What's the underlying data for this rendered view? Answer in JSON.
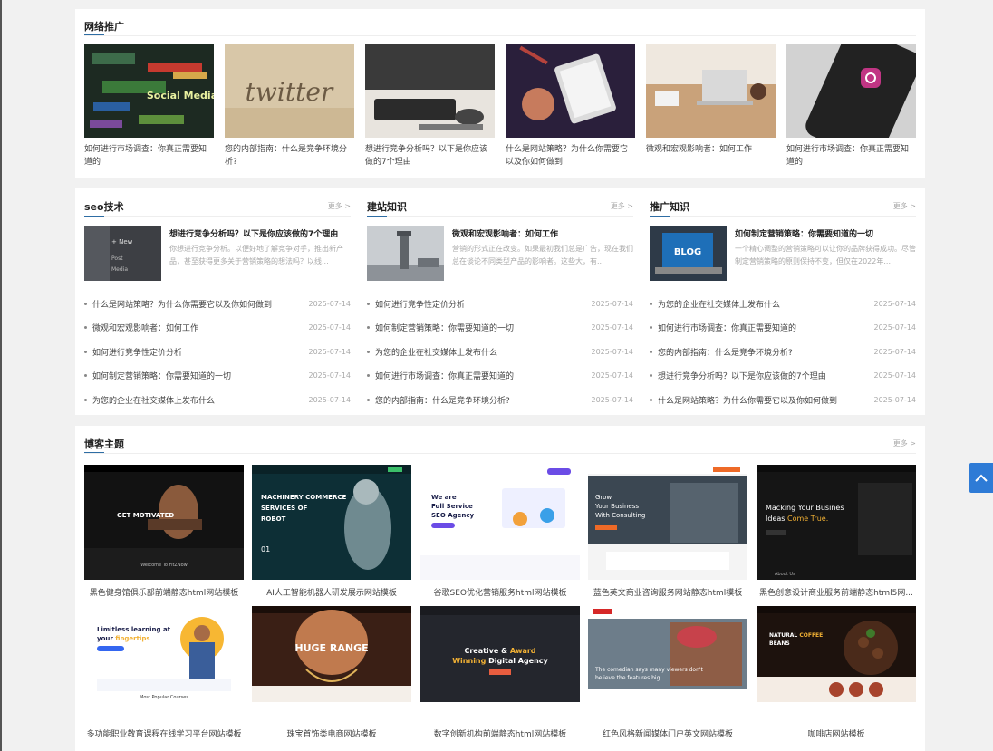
{
  "promo": {
    "title": "网络推广",
    "items": [
      {
        "caption": "如何进行市场调查：你真正需要知道的"
      },
      {
        "caption": "您的内部指南：什么是竞争环境分析?"
      },
      {
        "caption": "想进行竞争分析吗？以下是你应该做的7个理由"
      },
      {
        "caption": "什么是网站策略？为什么你需要它以及你如何做到"
      },
      {
        "caption": "微观和宏观影响者：如何工作"
      },
      {
        "caption": "如何进行市场调查：你真正需要知道的"
      }
    ]
  },
  "columns": [
    {
      "title": "seo技术",
      "more": "更多 >",
      "featured": {
        "title": "想进行竞争分析吗？以下是你应该做的7个理由",
        "desc": "你想进行竞争分析。以便好地了解竞争对手，推出新产品，甚至获得更多关于营销策略的想法吗？以线..."
      },
      "items": [
        {
          "text": "什么是网站策略？为什么你需要它以及你如何做到",
          "date": "2025-07-14"
        },
        {
          "text": "微观和宏观影响者：如何工作",
          "date": "2025-07-14"
        },
        {
          "text": "如何进行竞争性定价分析",
          "date": "2025-07-14"
        },
        {
          "text": "如何制定营销策略：你需要知道的一切",
          "date": "2025-07-14"
        },
        {
          "text": "为您的企业在社交媒体上发布什么",
          "date": "2025-07-14"
        }
      ]
    },
    {
      "title": "建站知识",
      "more": "更多 >",
      "featured": {
        "title": "微观和宏观影响者：如何工作",
        "desc": "营销的形式正在改变。如果最初我们总是广告，现在我们总在谈论不同类型产品的影响者。这些大，有..."
      },
      "items": [
        {
          "text": "如何进行竞争性定价分析",
          "date": "2025-07-14"
        },
        {
          "text": "如何制定营销策略：你需要知道的一切",
          "date": "2025-07-14"
        },
        {
          "text": "为您的企业在社交媒体上发布什么",
          "date": "2025-07-14"
        },
        {
          "text": "如何进行市场调查：你真正需要知道的",
          "date": "2025-07-14"
        },
        {
          "text": "您的内部指南：什么是竞争环境分析?",
          "date": "2025-07-14"
        }
      ]
    },
    {
      "title": "推广知识",
      "more": "更多 >",
      "featured": {
        "title": "如何制定营销策略：你需要知道的一切",
        "desc": "一个精心调整的营销策略可以让你的品牌获得成功。尽管制定营销策略的原则保持不变，但仅在2022年..."
      },
      "items": [
        {
          "text": "为您的企业在社交媒体上发布什么",
          "date": "2025-07-14"
        },
        {
          "text": "如何进行市场调查：你真正需要知道的",
          "date": "2025-07-14"
        },
        {
          "text": "您的内部指南：什么是竞争环境分析?",
          "date": "2025-07-14"
        },
        {
          "text": "想进行竞争分析吗？以下是你应该做的7个理由",
          "date": "2025-07-14"
        },
        {
          "text": "什么是网站策略？为什么你需要它以及你如何做到",
          "date": "2025-07-14"
        }
      ]
    }
  ],
  "themes": {
    "title": "博客主题",
    "more": "更多 >",
    "items": [
      {
        "caption": "黑色健身馆俱乐部前端静态html网站模板",
        "img_text": "GET MOTIVATED"
      },
      {
        "caption": "AI人工智能机器人研发展示网站模板",
        "img_text": "MACHINERY COMMERCE SERVICES OF ROBOT"
      },
      {
        "caption": "谷歌SEO优化营销服务html网站模板",
        "img_text": "We are Full Service SEO Agency"
      },
      {
        "caption": "蓝色英文商业咨询服务网站静态html模板",
        "img_text": "Grow Your Business With Consulting"
      },
      {
        "caption": "黑色创意设计商业服务前端静态html5网...",
        "img_text": "Macking Your Busines Ideas Come True."
      },
      {
        "caption": "多功能职业教育课程在线学习平台网站模板",
        "img_text": "Limitless learning at your fingertips"
      },
      {
        "caption": "珠宝首饰类电商网站模板",
        "img_text": "HUGE RANGE"
      },
      {
        "caption": "数字创新机构前端静态html网站模板",
        "img_text": "Creative & Award Winning Digital Agency"
      },
      {
        "caption": "红色风格新闻媒体门户英文网站模板",
        "img_text": "The comedian says many viewers don't believe the features big"
      },
      {
        "caption": "咖啡店网站模板",
        "img_text": "NATURAL COFFEE BEANS"
      }
    ]
  }
}
